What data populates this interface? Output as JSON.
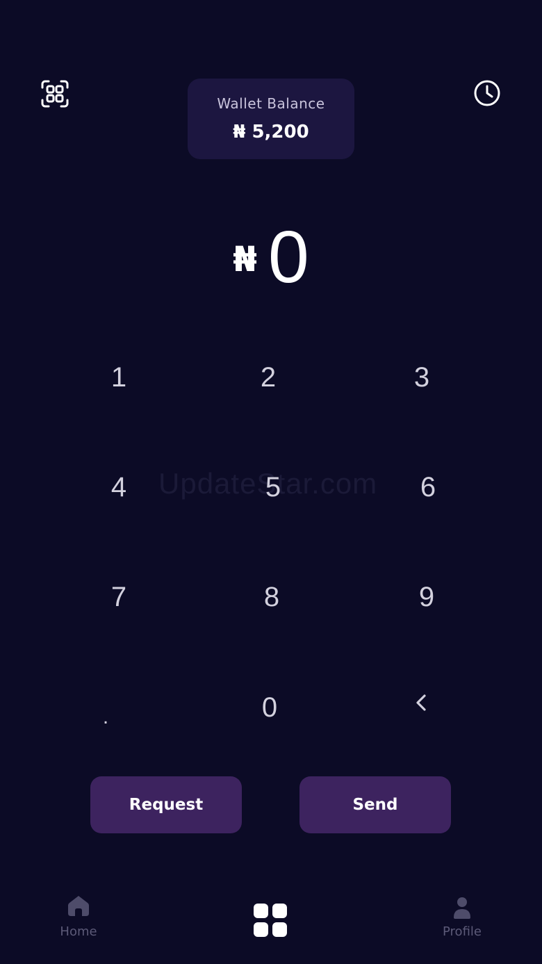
{
  "header": {
    "scan_icon": "qr-scan-icon",
    "history_icon": "clock-icon"
  },
  "wallet": {
    "label": "Wallet Balance",
    "value": "₦ 5,200"
  },
  "amount": {
    "currency": "₦",
    "value": "0"
  },
  "keypad": {
    "keys": [
      "1",
      "2",
      "3",
      "4",
      "5",
      "6",
      "7",
      "8",
      "9",
      ".",
      "0"
    ],
    "backspace": "‹"
  },
  "actions": {
    "request_label": "Request",
    "send_label": "Send"
  },
  "watermark": "UpdateStar.com",
  "nav": {
    "home_label": "Home",
    "profile_label": "Profile"
  },
  "colors": {
    "background": "#0c0b26",
    "card": "#1c1640",
    "button": "#3d235f",
    "nav_inactive": "#5c5a78"
  }
}
